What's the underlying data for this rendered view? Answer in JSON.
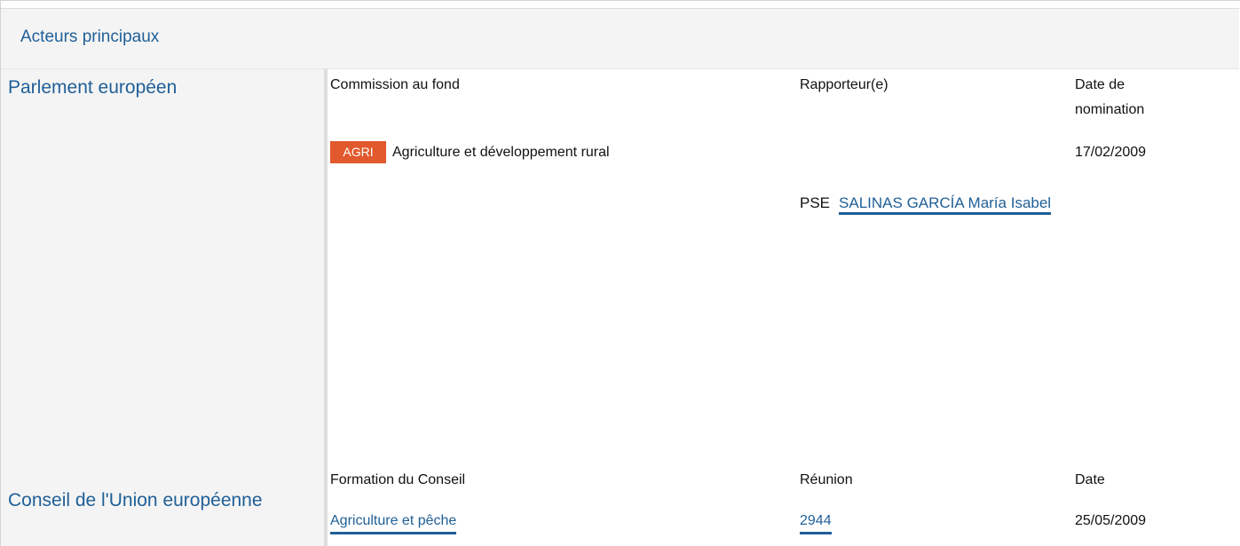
{
  "section_title": "Acteurs principaux",
  "parliament": {
    "institution": "Parlement européen",
    "headers": {
      "committee": "Commission au fond",
      "rapporteur": "Rapporteur(e)",
      "date_line1": "Date de",
      "date_line2": "nomination"
    },
    "committee": {
      "badge": "AGRI",
      "badge_color": "#e1592c",
      "name": "Agriculture et développement rural",
      "date": "17/02/2009"
    },
    "rapporteur": {
      "party": "PSE",
      "name_line1": "SALINAS GARCÍA María",
      "name_line2": "Isabel"
    }
  },
  "council": {
    "institution": "Conseil de l'Union européenne",
    "headers": {
      "formation": "Formation du Conseil",
      "meeting": "Réunion",
      "date": "Date"
    },
    "row": {
      "formation": "Agriculture et pêche",
      "meeting": "2944",
      "date": "25/05/2009"
    }
  },
  "colors": {
    "link": "#1f5f97",
    "panel": "#f4f4f4"
  }
}
